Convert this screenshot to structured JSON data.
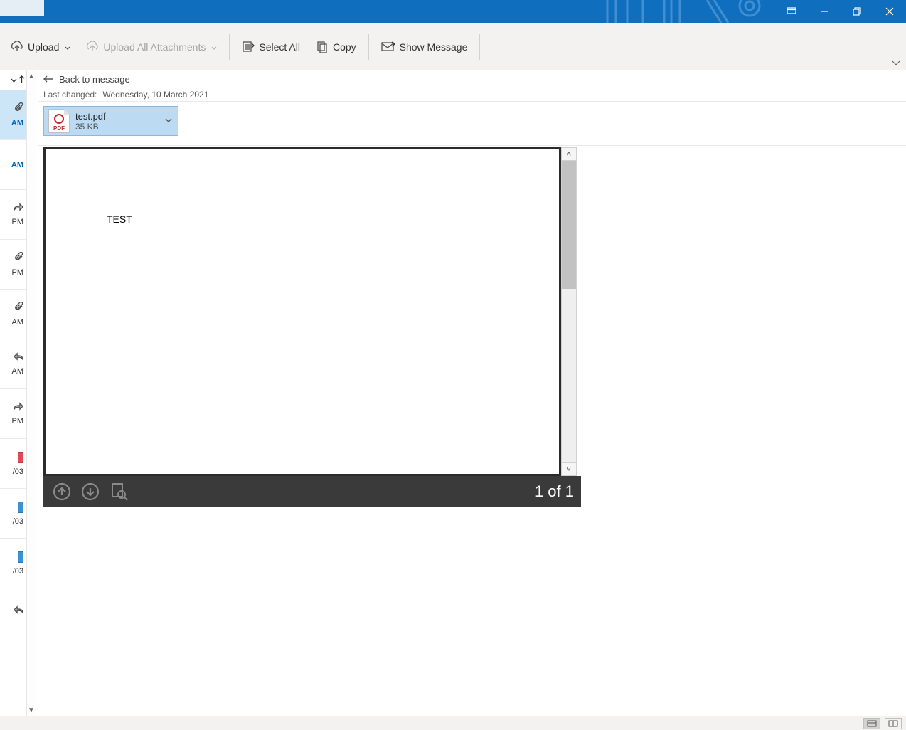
{
  "ribbon": {
    "upload_label": "Upload",
    "upload_all_label": "Upload All Attachments",
    "select_all_label": "Select All",
    "copy_label": "Copy",
    "show_message_label": "Show Message"
  },
  "nav": {
    "back_label": "Back to message"
  },
  "meta": {
    "last_changed_label": "Last changed:",
    "last_changed_value": "Wednesday, 10 March 2021"
  },
  "attachment": {
    "filename": "test.pdf",
    "size": "35 KB"
  },
  "pdf": {
    "body_text": "TEST",
    "page_indicator": "1 of 1"
  },
  "mail_list": [
    {
      "time": "AM",
      "icon": "attachment",
      "selected": true,
      "unread": true
    },
    {
      "time": "AM",
      "icon": "none",
      "unread": true
    },
    {
      "time": "PM",
      "icon": "forward"
    },
    {
      "time": "PM",
      "icon": "attachment"
    },
    {
      "time": "AM",
      "icon": "attachment"
    },
    {
      "time": "AM",
      "icon": "reply"
    },
    {
      "time": "PM",
      "icon": "forward"
    },
    {
      "time": "/03",
      "icon": "category-red"
    },
    {
      "time": "/03",
      "icon": "category-blue"
    },
    {
      "time": "/03",
      "icon": "category-blue"
    },
    {
      "time": "",
      "icon": "reply"
    }
  ]
}
